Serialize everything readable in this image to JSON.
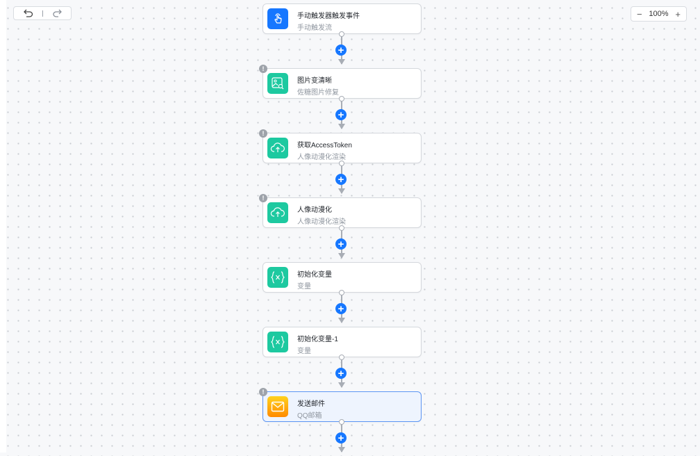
{
  "toolbar": {
    "zoom": "100%",
    "zoom_out": "−",
    "zoom_in": "+"
  },
  "nodes": [
    {
      "title": "手动触发器触发事件",
      "subtitle": "手动触发流",
      "icon": "hand-pointer-icon",
      "color": "#1677ff",
      "warning": false
    },
    {
      "title": "图片变清晰",
      "subtitle": "佐糖图片修复",
      "icon": "image-enhance-icon",
      "color": "#1dc9a0",
      "warning": true
    },
    {
      "title": "获取AccessToken",
      "subtitle": "人像动漫化渲染",
      "icon": "cloud-upload-icon",
      "color": "#1dc9a0",
      "warning": true
    },
    {
      "title": "人像动漫化",
      "subtitle": "人像动漫化渲染",
      "icon": "cloud-upload-icon",
      "color": "#1dc9a0",
      "warning": true
    },
    {
      "title": "初始化变量",
      "subtitle": "变量",
      "icon": "variable-icon",
      "color": "#1dc9a0",
      "warning": false
    },
    {
      "title": "初始化变量-1",
      "subtitle": "变量",
      "icon": "variable-icon",
      "color": "#1dc9a0",
      "warning": false
    },
    {
      "title": "发送邮件",
      "subtitle": "QQ邮箱",
      "icon": "mail-icon",
      "color": "#ff9d00",
      "warning": true,
      "selected": true
    }
  ],
  "warning_glyph": "!",
  "add_glyph": "+"
}
